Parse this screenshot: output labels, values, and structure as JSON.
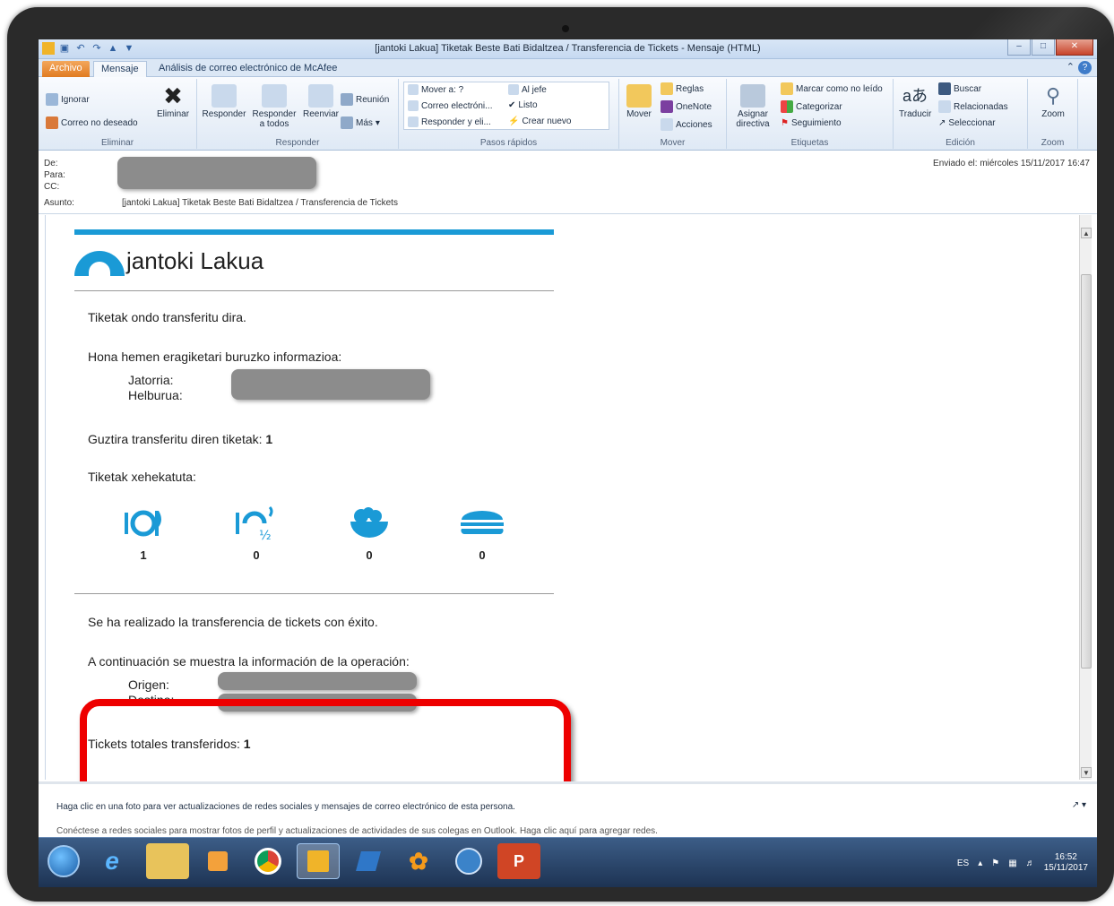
{
  "window": {
    "title": "[jantoki Lakua] Tiketak Beste Bati Bidaltzea / Transferencia de Tickets  -  Mensaje (HTML)"
  },
  "tabs": [
    {
      "label": "Archivo"
    },
    {
      "label": "Mensaje"
    },
    {
      "label": "Análisis de correo electrónico de McAfee"
    }
  ],
  "ribbon": {
    "eliminar": {
      "ignore": "Ignorar",
      "junk": "Correo no deseado",
      "delete": "Eliminar",
      "group": "Eliminar"
    },
    "responder": {
      "reply": "Responder",
      "reply_all": "Responder a todos",
      "forward": "Reenviar",
      "meeting": "Reunión",
      "more": "Más",
      "group": "Responder"
    },
    "pasos": {
      "move_to": "Mover a: ?",
      "email": "Correo electróni...",
      "reply_del": "Responder y eli...",
      "boss": "Al jefe",
      "done": "Listo",
      "create": "Crear nuevo",
      "group": "Pasos rápidos"
    },
    "mover": {
      "move": "Mover",
      "rules": "Reglas",
      "onenote": "OneNote",
      "actions": "Acciones",
      "group": "Mover"
    },
    "etiquetas": {
      "assign": "Asignar directiva",
      "unread": "Marcar como no leído",
      "categorize": "Categorizar",
      "followup": "Seguimiento",
      "group": "Etiquetas"
    },
    "edicion": {
      "translate": "Traducir",
      "find": "Buscar",
      "related": "Relacionadas",
      "select": "Seleccionar",
      "group": "Edición"
    },
    "zoom": {
      "zoom": "Zoom",
      "group": "Zoom"
    }
  },
  "header": {
    "from_label": "De:",
    "to_label": "Para:",
    "cc_label": "CC:",
    "subject_label": "Asunto:",
    "subject": "[jantoki Lakua] Tiketak Beste Bati Bidaltzea / Transferencia de Tickets",
    "sent_label": "Enviado el:",
    "sent_value": "miércoles 15/11/2017 16:47"
  },
  "email": {
    "logo_bold": "jantoki",
    "logo_rest": " Lakua",
    "eu_success": "Tiketak ondo transferitu dira.",
    "eu_info": "Hona hemen eragiketari buruzko informazioa:",
    "eu_origin_label": "Jatorria:",
    "eu_dest_label": "Helburua:",
    "eu_total_label": "Guztira transferitu diren tiketak:",
    "eu_total_value": "1",
    "eu_breakdown": "Tiketak xehekatuta:",
    "tickets": [
      {
        "icon": "full-meal-icon",
        "count": "1"
      },
      {
        "icon": "half-meal-icon",
        "count": "0"
      },
      {
        "icon": "salad-bowl-icon",
        "count": "0"
      },
      {
        "icon": "sandwich-icon",
        "count": "0"
      }
    ],
    "es_success": "Se ha realizado la transferencia de tickets con éxito.",
    "es_info": "A continuación se muestra la información de la operación:",
    "es_origin_label": "Origen:",
    "es_dest_label": "Destino:",
    "es_total_label": "Tickets totales transferidos:",
    "es_total_value": "1"
  },
  "people_pane": {
    "line1": "Haga clic en una foto para ver actualizaciones de redes sociales y mensajes de correo electrónico de esta persona.",
    "line2": "Conéctese a redes sociales para mostrar fotos de perfil y actualizaciones de actividades de sus colegas en Outlook. Haga clic aquí para agregar redes."
  },
  "taskbar": {
    "lang": "ES",
    "time": "16:52",
    "date": "15/11/2017"
  },
  "colors": {
    "brand": "#1a9ad6",
    "highlight": "#ee0000"
  }
}
